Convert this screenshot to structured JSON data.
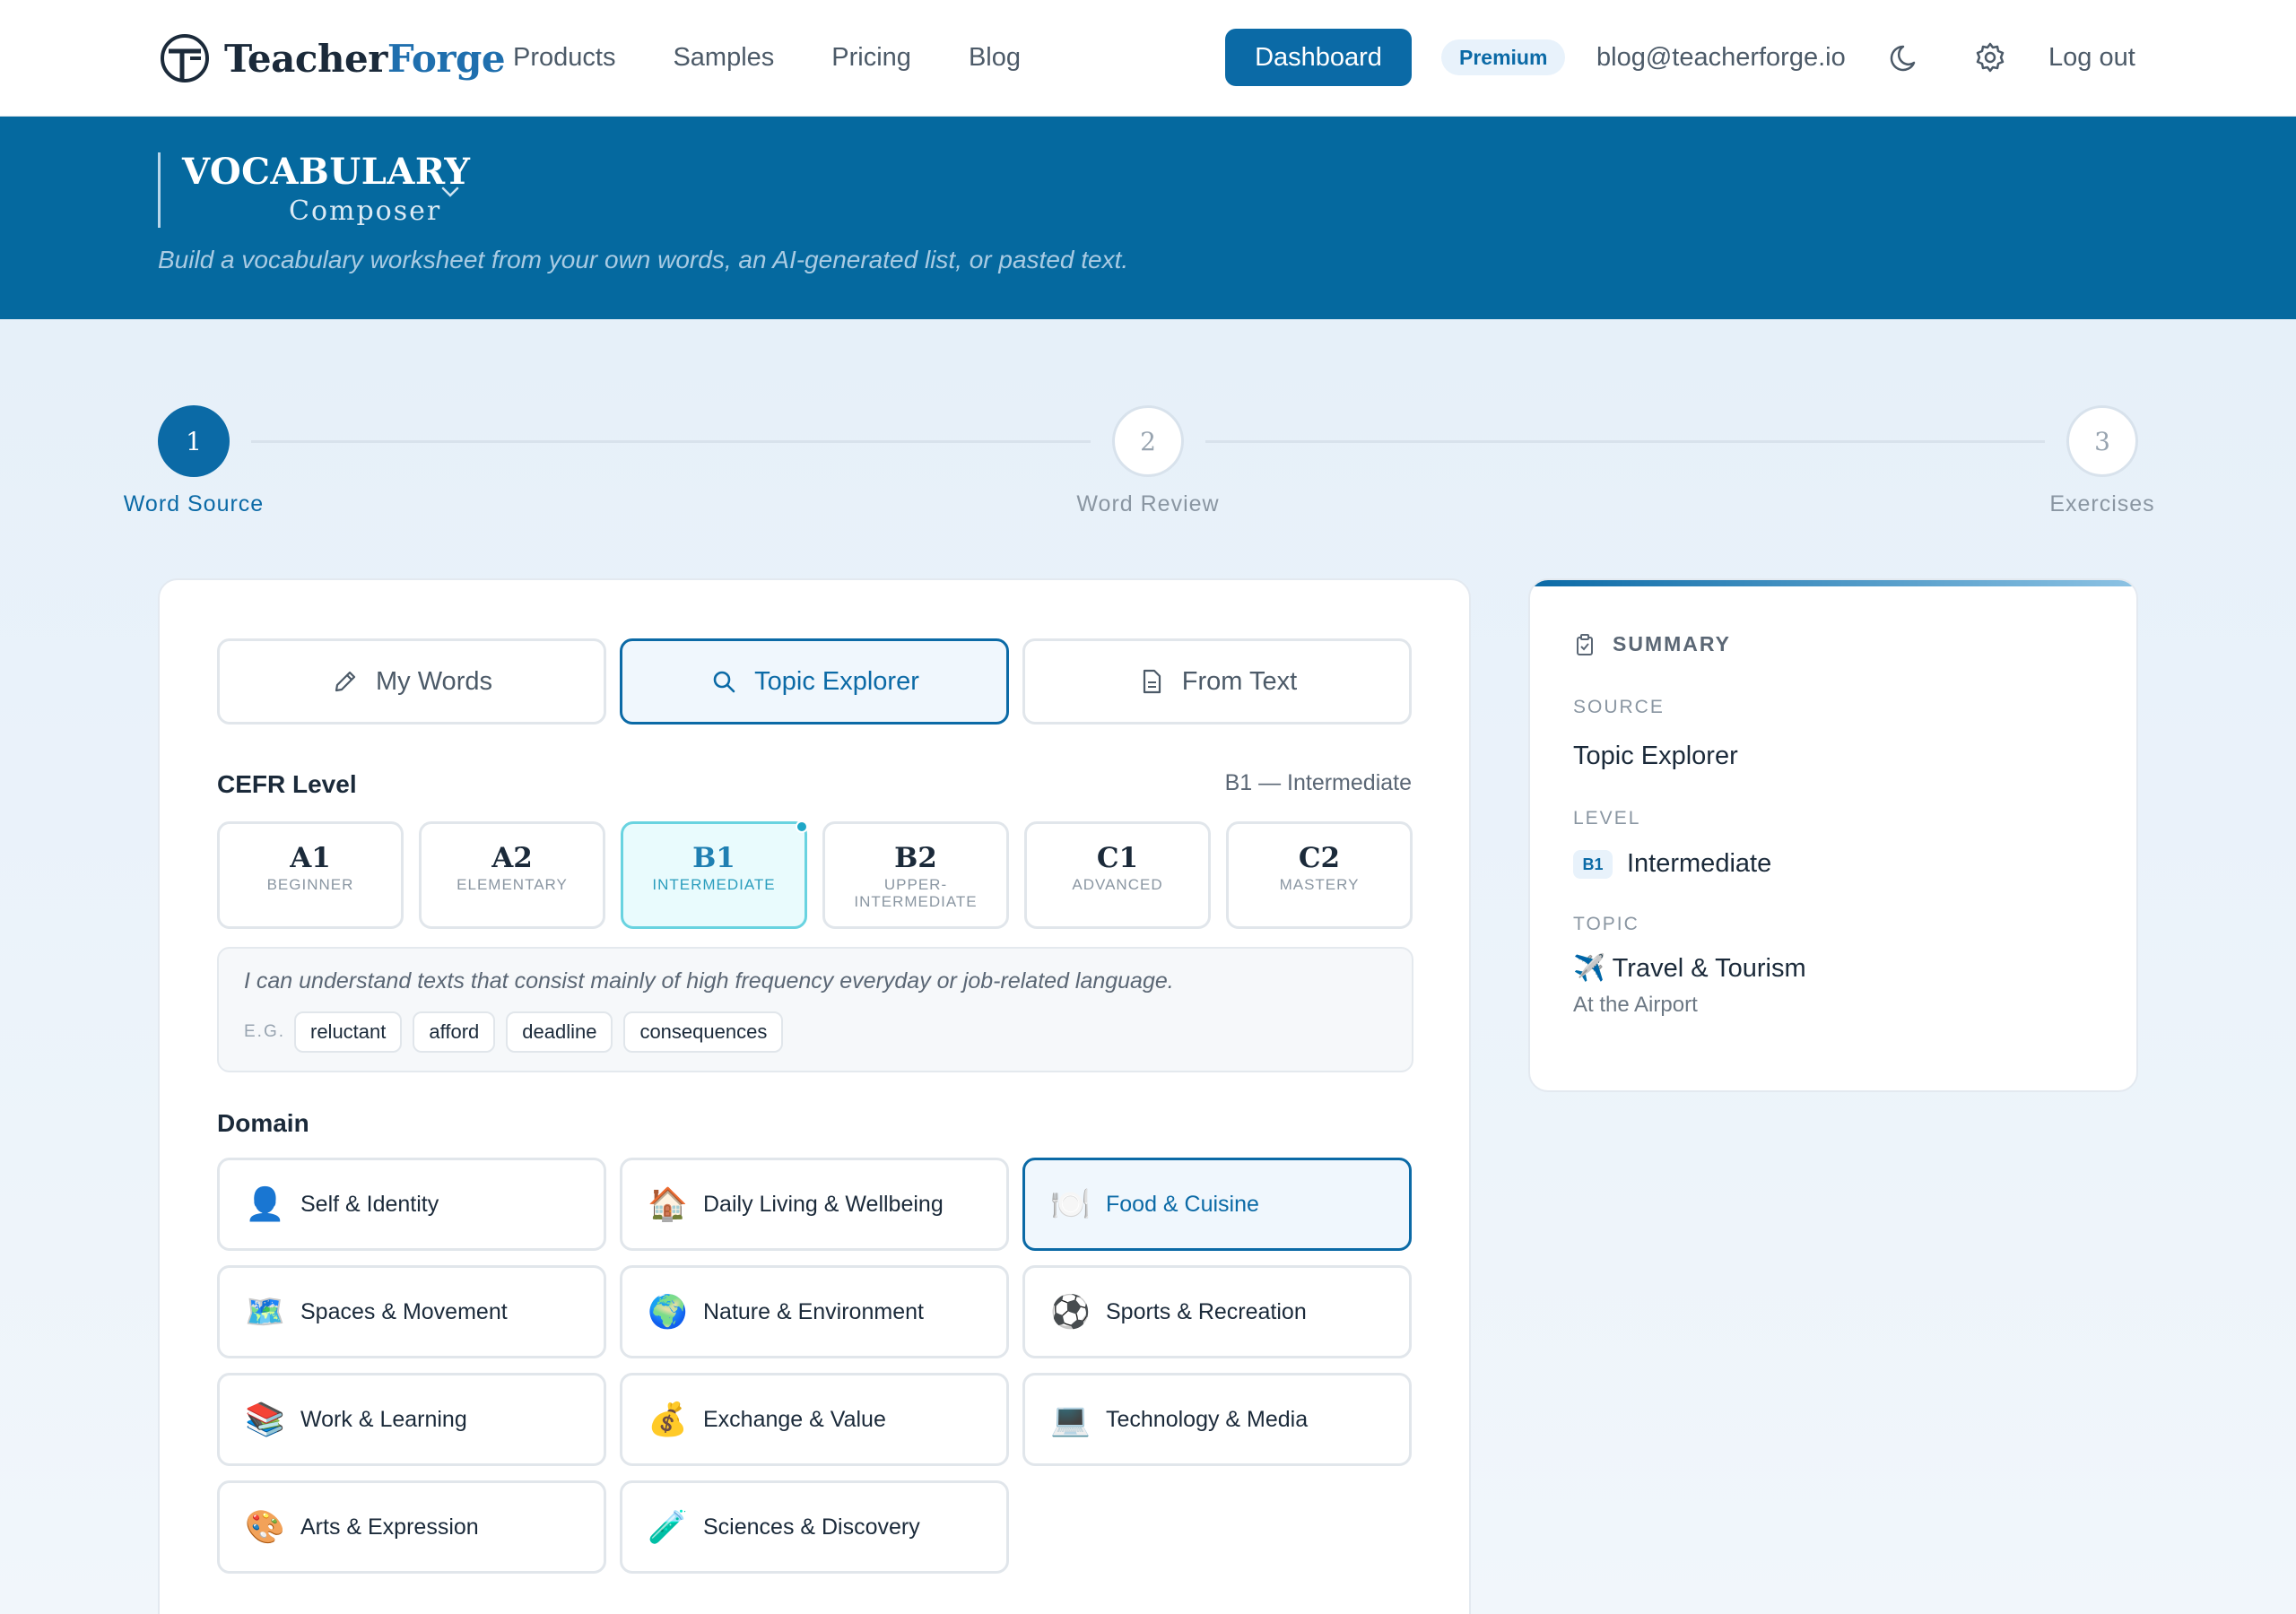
{
  "nav": {
    "logo_part1": "Teacher",
    "logo_part2": "Forge",
    "links": [
      "Products",
      "Samples",
      "Pricing",
      "Blog"
    ],
    "dashboard_label": "Dashboard",
    "premium_label": "Premium",
    "email": "blog@teacherforge.io",
    "logout_label": "Log out"
  },
  "hero": {
    "title": "VOCABULARY",
    "subtitle": "Composer",
    "description": "Build a vocabulary worksheet from your own words, an AI-generated list, or pasted text."
  },
  "steps": [
    {
      "number": "1",
      "label": "Word Source",
      "state": "active"
    },
    {
      "number": "2",
      "label": "Word Review",
      "state": "idle"
    },
    {
      "number": "3",
      "label": "Exercises",
      "state": "idle"
    }
  ],
  "mode_tabs": [
    {
      "label": "My Words",
      "icon": "pencil-icon",
      "selected": false
    },
    {
      "label": "Topic Explorer",
      "icon": "search-icon",
      "selected": true
    },
    {
      "label": "From Text",
      "icon": "document-icon",
      "selected": false
    }
  ],
  "cefr": {
    "title": "CEFR Level",
    "selected_note": "B1 — Intermediate",
    "levels": [
      {
        "code": "A1",
        "name": "BEGINNER"
      },
      {
        "code": "A2",
        "name": "ELEMENTARY"
      },
      {
        "code": "B1",
        "name": "INTERMEDIATE"
      },
      {
        "code": "B2",
        "name": "UPPER-INTERMEDIATE"
      },
      {
        "code": "C1",
        "name": "ADVANCED"
      },
      {
        "code": "C2",
        "name": "MASTERY"
      }
    ],
    "selected_index": 2,
    "description": "I can understand texts that consist mainly of high frequency everyday or job-related language.",
    "eg_label": "E.G.",
    "examples": [
      "reluctant",
      "afford",
      "deadline",
      "consequences"
    ]
  },
  "domain": {
    "title": "Domain",
    "items": [
      {
        "icon": "👤",
        "label": "Self & Identity"
      },
      {
        "icon": "🏠",
        "label": "Daily Living & Wellbeing"
      },
      {
        "icon": "🍽️",
        "label": "Food & Cuisine"
      },
      {
        "icon": "🗺️",
        "label": "Spaces & Movement"
      },
      {
        "icon": "🌍",
        "label": "Nature & Environment"
      },
      {
        "icon": "⚽",
        "label": "Sports & Recreation"
      },
      {
        "icon": "📚",
        "label": "Work & Learning"
      },
      {
        "icon": "💰",
        "label": "Exchange & Value"
      },
      {
        "icon": "💻",
        "label": "Technology & Media"
      },
      {
        "icon": "🎨",
        "label": "Arts & Expression"
      },
      {
        "icon": "🧪",
        "label": "Sciences & Discovery"
      }
    ],
    "selected_index": 2
  },
  "summary": {
    "title": "SUMMARY",
    "source_label": "SOURCE",
    "source_value": "Topic Explorer",
    "level_label": "LEVEL",
    "level_badge": "B1",
    "level_value": "Intermediate",
    "topic_label": "TOPIC",
    "topic_icon": "✈️",
    "topic_value": "Travel & Tourism",
    "topic_sub": "At the Airport"
  },
  "colors": {
    "brand": "#0b6aa6",
    "hero_bg": "#05699f",
    "level_highlight": "#69d3e0"
  }
}
